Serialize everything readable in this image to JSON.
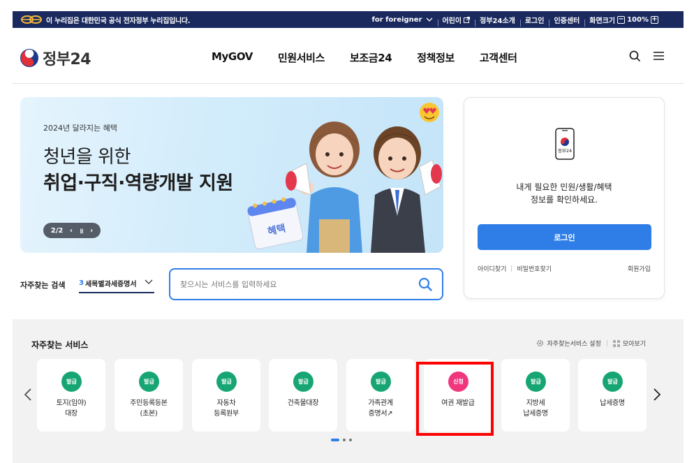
{
  "topbar": {
    "notice": "이 누리집은 대한민국 공식 전자정부 누리집입니다.",
    "foreigner": "for foreigner",
    "kids": "어린이",
    "intro": "정부24소개",
    "login": "로그인",
    "cert": "인증센터",
    "zoom_label": "화면크기",
    "zoom_minus": "−",
    "zoom_value": "100%",
    "zoom_plus": "+"
  },
  "header": {
    "logo_text": "정부24",
    "menu": [
      "MyGOV",
      "민원서비스",
      "보조금24",
      "정책정보",
      "고객센터"
    ]
  },
  "banner": {
    "subtitle": "2024년 달라지는 혜택",
    "title_line1": "청년을 위한",
    "title_line2": "취업·구직·역량개발 지원",
    "page": "2/2",
    "prev": "‹",
    "pause": "॥",
    "next": "›",
    "badge": "혜택"
  },
  "login_card": {
    "phone_label": "정부24",
    "message_line1": "내게 필요한 민원/생활/혜택",
    "message_line2": "정보를 확인하세요.",
    "login_button": "로그인",
    "find_id": "아이디찾기",
    "find_pw": "비밀번호찾기",
    "join": "회원가입"
  },
  "search": {
    "label": "자주찾는 검색",
    "rank": "3",
    "selected": "세목별과세증명서",
    "placeholder": "찾으시는 서비스를 입력하세요",
    "value": ""
  },
  "frequent": {
    "title": "자주찾는 서비스",
    "settings": "자주찾는서비스 설정",
    "view_all": "모아보기",
    "items": [
      {
        "badge": "발급",
        "line1": "토지(임야)",
        "line2": "대장",
        "color": "#17a673"
      },
      {
        "badge": "발급",
        "line1": "주민등록등본",
        "line2": "(초본)",
        "color": "#17a673"
      },
      {
        "badge": "발급",
        "line1": "자동차",
        "line2": "등록원부",
        "color": "#17a673"
      },
      {
        "badge": "발급",
        "line1": "건축물대장",
        "line2": "",
        "color": "#17a673"
      },
      {
        "badge": "발급",
        "line1": "가족관계",
        "line2": "증명서↗",
        "color": "#17a673"
      },
      {
        "badge": "신청",
        "line1": "여권 재발급",
        "line2": "",
        "color": "#f0377e"
      },
      {
        "badge": "발급",
        "line1": "지방세",
        "line2": "납세증명",
        "color": "#17a673"
      },
      {
        "badge": "발급",
        "line1": "납세증명",
        "line2": "",
        "color": "#17a673"
      }
    ]
  },
  "colors": {
    "navy": "#1a2a5e",
    "primary": "#2f7ee8",
    "issue_badge": "#17a673",
    "apply_badge": "#f0377e",
    "highlight": "#ff0000"
  }
}
